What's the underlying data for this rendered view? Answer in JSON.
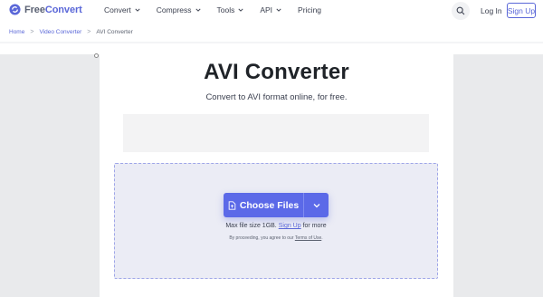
{
  "header": {
    "logo_prefix": "Free",
    "logo_suffix": "Convert",
    "nav": [
      {
        "label": "Convert",
        "has_dropdown": true
      },
      {
        "label": "Compress",
        "has_dropdown": true
      },
      {
        "label": "Tools",
        "has_dropdown": true
      },
      {
        "label": "API",
        "has_dropdown": true
      },
      {
        "label": "Pricing",
        "has_dropdown": false
      }
    ],
    "login_label": "Log In",
    "signup_label": "Sign Up",
    "search_icon": "search-icon"
  },
  "breadcrumb": {
    "items": [
      "Home",
      "Video Converter"
    ],
    "current": "AVI Converter",
    "separator": ">"
  },
  "main": {
    "title": "AVI Converter",
    "subtitle": "Convert to AVI format online, for free."
  },
  "upload": {
    "choose_label": "Choose Files",
    "max_size_prefix": "Max file size 1GB.",
    "signup_link": "Sign Up",
    "max_size_suffix": "for more",
    "terms_prefix": "By proceeding, you agree to our",
    "terms_link": "Terms of Use",
    "terms_suffix": "."
  },
  "colors": {
    "accent": "#5b69e8",
    "dropzone_bg": "#ebecf5",
    "side_bg": "#e9eaec"
  }
}
